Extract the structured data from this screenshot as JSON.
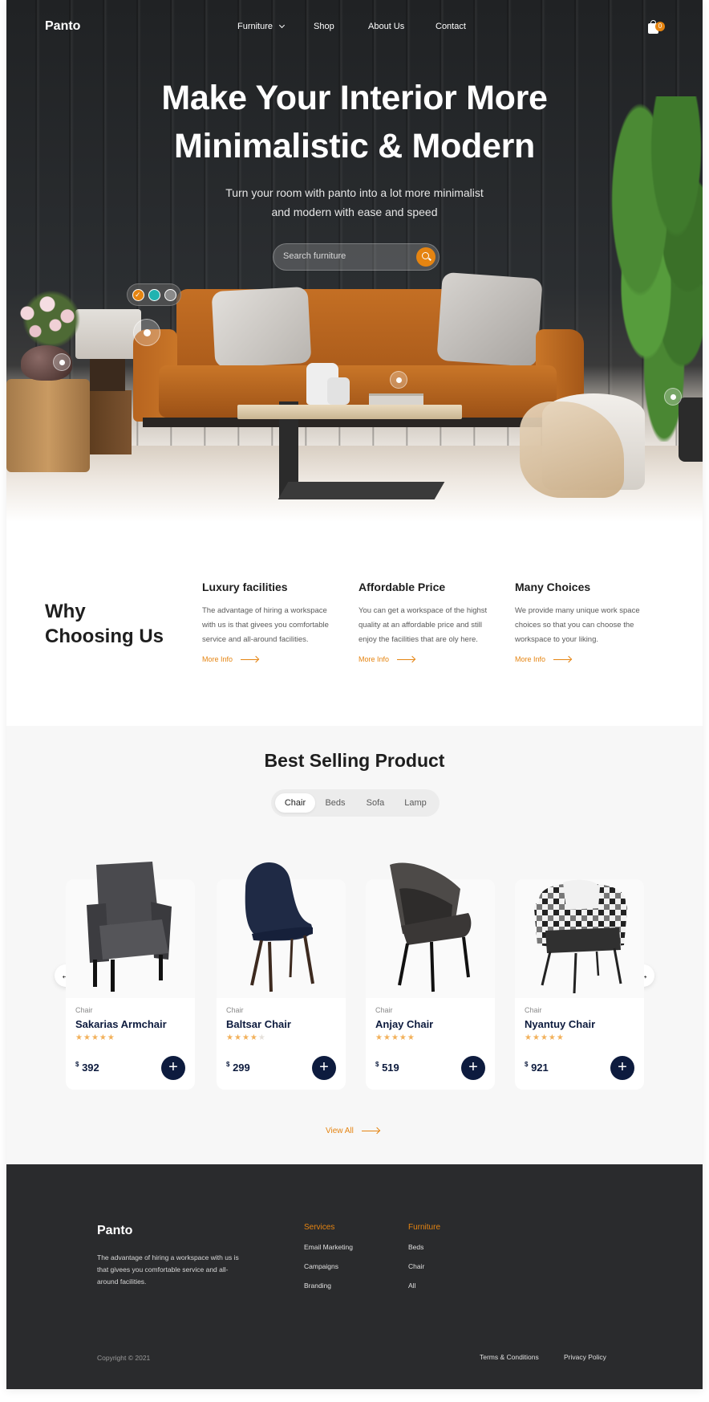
{
  "brand": {
    "name": "Panto",
    "accent_color": "#E58411",
    "navy_color": "#0D1B3E"
  },
  "nav": {
    "items": [
      "Furniture",
      "Shop",
      "About Us",
      "Contact"
    ],
    "cart_count": "0"
  },
  "hero": {
    "title_line1": "Make Your Interior More",
    "title_line2": "Minimalistic & Modern",
    "subtitle_line1": "Turn your room with panto into a lot more minimalist",
    "subtitle_line2": "and modern with ease and speed",
    "search_placeholder": "Search furniture",
    "color_swatches": [
      "#E58411",
      "#21B3B0",
      "#8A8A8A"
    ]
  },
  "why": {
    "title_line1": "Why",
    "title_line2": "Choosing Us",
    "features": [
      {
        "title": "Luxury facilities",
        "text": "The advantage of hiring a workspace with us is that givees you comfortable service and all-around facilities.",
        "link": "More Info"
      },
      {
        "title": "Affordable Price",
        "text": "You can get a workspace of the highst quality at an affordable price and still enjoy the facilities that are oly here.",
        "link": "More Info"
      },
      {
        "title": "Many Choices",
        "text": "We provide many unique work space choices so that you can choose the workspace to your liking.",
        "link": "More Info"
      }
    ]
  },
  "best": {
    "title": "Best Selling Product",
    "tabs": [
      "Chair",
      "Beds",
      "Sofa",
      "Lamp"
    ],
    "active_tab": "Chair",
    "currency": "$",
    "products": [
      {
        "category": "Chair",
        "name": "Sakarias Armchair",
        "rating": 5,
        "price": "392"
      },
      {
        "category": "Chair",
        "name": "Baltsar Chair",
        "rating": 4,
        "price": "299"
      },
      {
        "category": "Chair",
        "name": "Anjay Chair",
        "rating": 5,
        "price": "519"
      },
      {
        "category": "Chair",
        "name": "Nyantuy Chair",
        "rating": 5,
        "price": "921"
      }
    ],
    "view_all": "View All"
  },
  "footer": {
    "brand": "Panto",
    "description": "The advantage of hiring a workspace with us is that givees you comfortable service and all-around facilities.",
    "services_title": "Services",
    "services": [
      "Email Marketing",
      "Campaigns",
      "Branding"
    ],
    "furniture_title": "Furniture",
    "furniture": [
      "Beds",
      "Chair",
      "All"
    ],
    "copyright": "Copyright © 2021",
    "terms": "Terms & Conditions",
    "privacy": "Privacy Policy"
  }
}
